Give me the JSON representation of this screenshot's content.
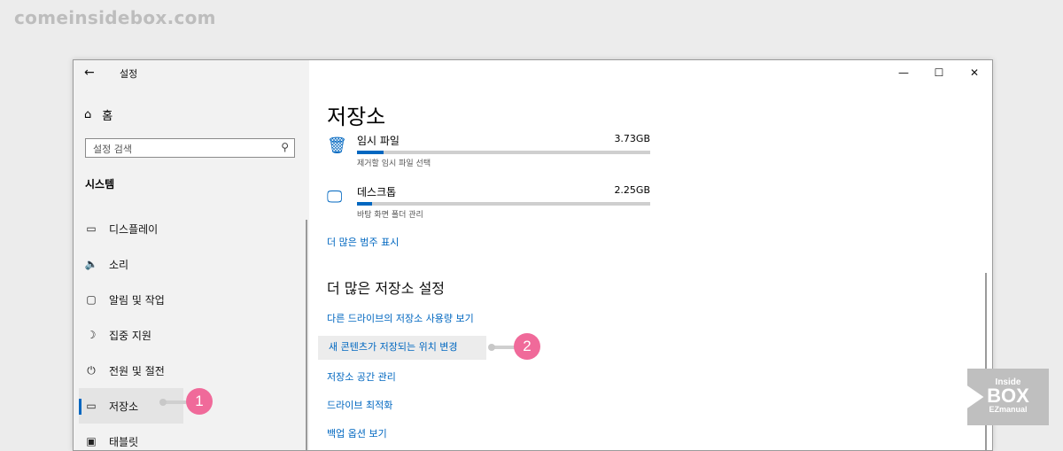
{
  "watermark": "comeinsidebox.com",
  "window": {
    "title": "설정",
    "back_icon": "←",
    "controls": {
      "minimize": "—",
      "maximize": "☐",
      "close": "✕"
    }
  },
  "sidebar": {
    "home": {
      "label": "홈",
      "icon": "⌂"
    },
    "search": {
      "placeholder": "설정 검색",
      "icon": "⚲"
    },
    "section_title": "시스템",
    "items": [
      {
        "label": "디스플레이",
        "icon": "▭"
      },
      {
        "label": "소리",
        "icon": "🔈"
      },
      {
        "label": "알림 및 작업",
        "icon": "▢"
      },
      {
        "label": "집중 지원",
        "icon": "☽"
      },
      {
        "label": "전원 및 절전",
        "icon": "⏻"
      },
      {
        "label": "저장소",
        "icon": "▭"
      },
      {
        "label": "태블릿",
        "icon": "▣"
      }
    ]
  },
  "main": {
    "title": "저장소",
    "storage": [
      {
        "label": "임시 파일",
        "size": "3.73GB",
        "sub": "제거할 임시 파일 선택",
        "icon": "🗑",
        "fill_pct": 9
      },
      {
        "label": "데스크톱",
        "size": "2.25GB",
        "sub": "바탕 화면 폴더 관리",
        "icon": "🖵",
        "fill_pct": 5
      }
    ],
    "show_more": "더 많은 범주 표시",
    "more_settings_heading": "더 많은 저장소 설정",
    "links": [
      "다른 드라이브의 저장소 사용량 보기",
      "새 콘텐츠가 저장되는 위치 변경",
      "저장소 공간 관리",
      "드라이브 최적화",
      "백업 옵션 보기"
    ]
  },
  "annotations": {
    "badge1": "1",
    "badge2": "2"
  },
  "logo": {
    "line1": "Inside",
    "line2": "BOX",
    "line3": "EZmanual"
  }
}
